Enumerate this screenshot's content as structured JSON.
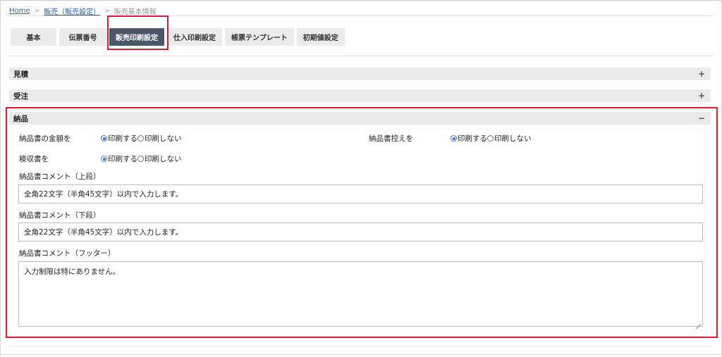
{
  "breadcrumb": {
    "items": [
      "Home",
      "販売（販売設定）",
      "販売基本情報"
    ],
    "separator": ">"
  },
  "tabs": [
    {
      "label": "基本",
      "active": false
    },
    {
      "label": "伝票番号",
      "active": false
    },
    {
      "label": "販売印刷設定",
      "active": true
    },
    {
      "label": "仕入印刷設定",
      "active": false
    },
    {
      "label": "帳票テンプレート",
      "active": false
    },
    {
      "label": "初期値設定",
      "active": false
    }
  ],
  "sections": {
    "mitsumori": {
      "title": "見積",
      "toggle": "+"
    },
    "juchu": {
      "title": "受注",
      "toggle": "+"
    },
    "nohin": {
      "title": "納品",
      "toggle": "−"
    }
  },
  "nohin_form": {
    "kingaku": {
      "label": "納品書の金額を",
      "options": [
        "印刷する",
        "印刷しない"
      ],
      "selected": "印刷する"
    },
    "hikae": {
      "label": "納品書控えを",
      "options": [
        "印刷する",
        "印刷しない"
      ],
      "selected": "印刷する"
    },
    "kenshu": {
      "label": "検収書を",
      "options": [
        "印刷する",
        "印刷しない"
      ],
      "selected": "印刷する"
    },
    "comment_upper": {
      "label": "納品書コメント（上段）",
      "value": "全角22文字（半角45文字）以内で入力します。"
    },
    "comment_lower": {
      "label": "納品書コメント（下段）",
      "value": "全角22文字（半角45文字）以内で入力します。"
    },
    "comment_footer": {
      "label": "納品書コメント（フッター）",
      "value": "入力制限は特にありません。"
    }
  },
  "colors": {
    "accent": "#4c5669",
    "highlight": "#e1192c",
    "link": "#2a64a6",
    "radio": "#3f6fd0"
  }
}
